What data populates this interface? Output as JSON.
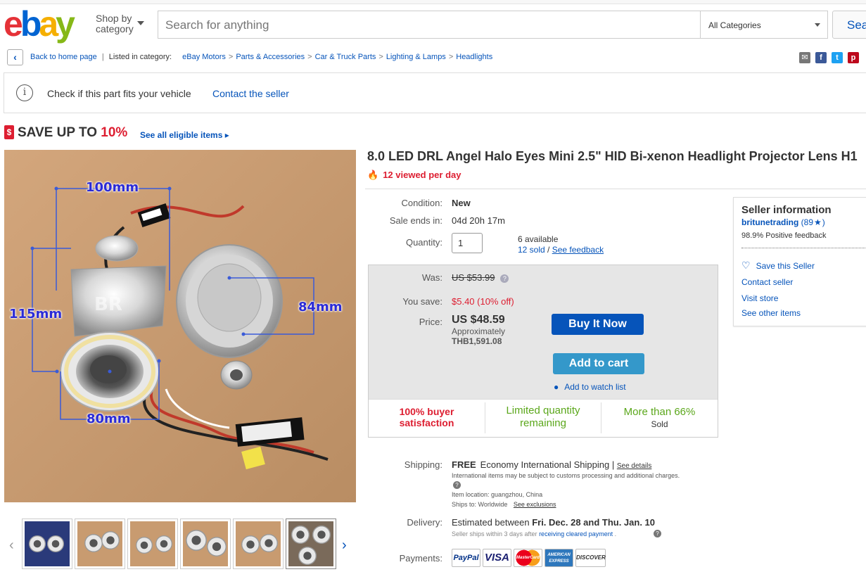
{
  "header": {
    "logo_letters": [
      "e",
      "b",
      "a",
      "y"
    ],
    "shop_by_line1": "Shop by",
    "shop_by_line2": "category",
    "search_placeholder": "Search for anything",
    "category_selected": "All Categories",
    "search_button": "Sea"
  },
  "breadcrumb": {
    "back_label": "Back to home page",
    "listed_in": "Listed in category:",
    "items": [
      "eBay Motors",
      "Parts & Accessories",
      "Car & Truck Parts",
      "Lighting & Lamps",
      "Headlights"
    ]
  },
  "share_icons": [
    "email-icon",
    "facebook-icon",
    "twitter-icon",
    "pinterest-icon"
  ],
  "fitbar": {
    "check_text": "Check if this part fits your vehicle",
    "contact_link": "Contact the seller"
  },
  "promo": {
    "save_text": "SAVE UP TO ",
    "save_pct": "10%",
    "see_all": "See all eligible items ▸"
  },
  "image": {
    "dim_top": "100mm",
    "dim_left": "115mm",
    "dim_right": "84mm",
    "dim_bottom": "80mm",
    "watermark": "BR"
  },
  "thumbnails_count": 6,
  "item": {
    "title": "8.0 LED DRL Angel Halo Eyes Mini 2.5\" HID Bi-xenon Headlight Projector Lens H1",
    "viewed": "12 viewed per day",
    "condition_label": "Condition:",
    "condition": "New",
    "sale_ends_label": "Sale ends in:",
    "sale_ends": "04d 20h 17m",
    "quantity_label": "Quantity:",
    "quantity_value": "1",
    "available": "6 available",
    "sold": "12 sold",
    "sold_sep": " / ",
    "see_feedback": "See feedback"
  },
  "pricing": {
    "was_label": "Was:",
    "was": "US $53.99",
    "save_label": "You save:",
    "save": "$5.40 (10% off)",
    "price_label": "Price:",
    "price": "US $48.59",
    "approx_label": "Approximately",
    "approx": "THB1,591.08",
    "buy_now": "Buy It Now",
    "add_to_cart": "Add to cart",
    "watch": "Add to watch list",
    "stat1_line1": "100% buyer",
    "stat1_line2": "satisfaction",
    "stat2_line1": "Limited quantity",
    "stat2_line2": "remaining",
    "stat3_line1": "More than 66%",
    "stat3_line2": "Sold"
  },
  "seller": {
    "heading": "Seller information",
    "name": "britunetrading",
    "score": "(89",
    "score_end": ")",
    "positive": "98.9% Positive feedback",
    "save_seller": "Save this Seller",
    "contact": "Contact seller",
    "visit": "Visit store",
    "other": "See other items"
  },
  "shipping": {
    "label": "Shipping:",
    "free": "FREE",
    "method": "Economy International Shipping",
    "sep": " | ",
    "see_details": "See details",
    "customs": "International items may be subject to customs processing and additional charges.",
    "location_label": "Item location:",
    "location": "guangzhou, China",
    "ships_label": "Ships to:",
    "ships_to": "Worldwide",
    "see_exclusions": "See exclusions"
  },
  "delivery": {
    "label": "Delivery:",
    "prefix": "Estimated between ",
    "dates": "Fri. Dec. 28 and Thu. Jan. 10",
    "note_prefix": "Seller ships within 3 days after ",
    "note_link": "receiving cleared payment",
    "note_suffix": " ."
  },
  "payments": {
    "label": "Payments:",
    "methods": [
      "PayPal",
      "VISA",
      "MasterCard",
      "AMERICAN EXPRESS",
      "DISCOVER"
    ]
  },
  "colors": {
    "ebay_red": "#e53238",
    "ebay_blue": "#0064d2",
    "ebay_yellow": "#f5af02",
    "ebay_green": "#86b817",
    "link": "#0654ba",
    "alert_red": "#dd1e31",
    "stat_green": "#5ba71b"
  }
}
